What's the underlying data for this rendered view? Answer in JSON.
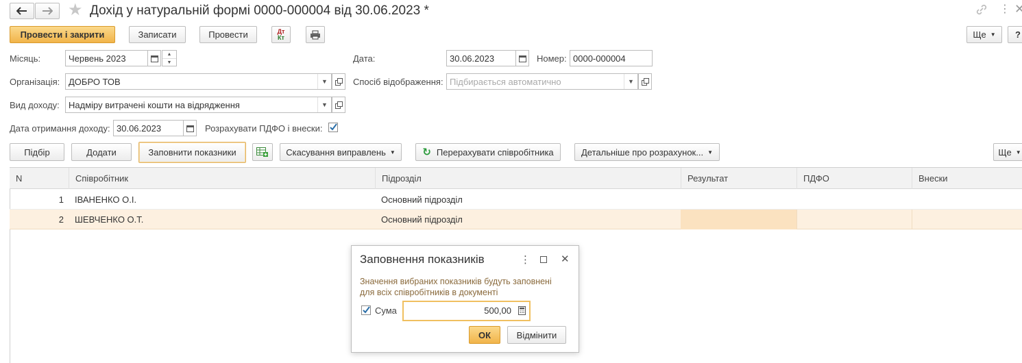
{
  "window": {
    "title": "Дохід у натуральній формі 0000-000004 від 30.06.2023 *"
  },
  "toolbar": {
    "post_close": "Провести і закрити",
    "save": "Записати",
    "post": "Провести",
    "more": "Ще",
    "help": "?"
  },
  "form": {
    "month_label": "Місяць:",
    "month_value": "Червень 2023",
    "date_label": "Дата:",
    "date_value": "30.06.2023",
    "number_label": "Номер:",
    "number_value": "0000-000004",
    "org_label": "Організація:",
    "org_value": "ДОБРО ТОВ",
    "display_label": "Спосіб відображення:",
    "display_placeholder": "Підбирається автоматично",
    "income_type_label": "Вид доходу:",
    "income_type_value": "Надміру витрачені кошти на відрядження",
    "receipt_date_label": "Дата отримання доходу:",
    "receipt_date_value": "30.06.2023",
    "calc_label": "Розрахувати ПДФО і внески:",
    "calc_checked": true
  },
  "table_toolbar": {
    "select": "Підбір",
    "add": "Додати",
    "fill": "Заповнити показники",
    "cancel_corrections": "Скасування виправлень",
    "recalculate": "Перерахувати співробітника",
    "details": "Детальніше про розрахунок...",
    "more": "Ще"
  },
  "table": {
    "columns": [
      "N",
      "Співробітник",
      "Підрозділ",
      "Результат",
      "ПДФО",
      "Внески"
    ],
    "rows": [
      {
        "n": "1",
        "employee": "ІВАНЕНКО О.І.",
        "department": "Основний підрозділ",
        "result": "",
        "pdfo": "",
        "contributions": ""
      },
      {
        "n": "2",
        "employee": "ШЕВЧЕНКО О.Т.",
        "department": "Основний підрозділ",
        "result": "",
        "pdfo": "",
        "contributions": ""
      }
    ]
  },
  "dialog": {
    "title": "Заповнення показників",
    "info": "Значення вибраних показників будуть заповнені для всіх співробітників в документі",
    "sum_label": "Сума",
    "sum_checked": true,
    "sum_value": "500,00",
    "ok": "ОК",
    "cancel": "Відмінити"
  },
  "colors": {
    "accent": "#f1b44a",
    "selected_row": "#fdf0e0",
    "selected_cell": "#fbe2c0",
    "dialog_text": "#8a6a3c"
  }
}
